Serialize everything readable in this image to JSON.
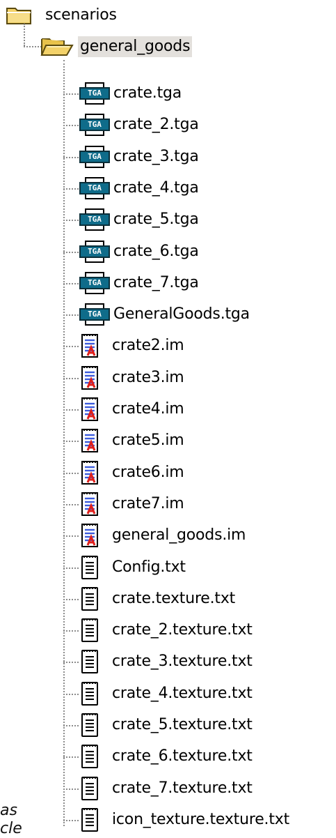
{
  "root": {
    "label": "scenarios",
    "icon": "folder-icon"
  },
  "folder": {
    "label": "general_goods",
    "icon": "folder-open-icon",
    "selected": true
  },
  "files": [
    {
      "label": "crate.tga",
      "icon": "tga-icon"
    },
    {
      "label": "crate_2.tga",
      "icon": "tga-icon"
    },
    {
      "label": "crate_3.tga",
      "icon": "tga-icon"
    },
    {
      "label": "crate_4.tga",
      "icon": "tga-icon"
    },
    {
      "label": "crate_5.tga",
      "icon": "tga-icon"
    },
    {
      "label": "crate_6.tga",
      "icon": "tga-icon"
    },
    {
      "label": "crate_7.tga",
      "icon": "tga-icon"
    },
    {
      "label": "GeneralGoods.tga",
      "icon": "tga-icon"
    },
    {
      "label": "crate2.im",
      "icon": "im-file-icon"
    },
    {
      "label": "crate3.im",
      "icon": "im-file-icon"
    },
    {
      "label": "crate4.im",
      "icon": "im-file-icon"
    },
    {
      "label": "crate5.im",
      "icon": "im-file-icon"
    },
    {
      "label": "crate6.im",
      "icon": "im-file-icon"
    },
    {
      "label": "crate7.im",
      "icon": "im-file-icon"
    },
    {
      "label": "general_goods.im",
      "icon": "im-file-icon"
    },
    {
      "label": "Config.txt",
      "icon": "text-file-icon"
    },
    {
      "label": "crate.texture.txt",
      "icon": "text-file-icon"
    },
    {
      "label": "crate_2.texture.txt",
      "icon": "text-file-icon"
    },
    {
      "label": "crate_3.texture.txt",
      "icon": "text-file-icon"
    },
    {
      "label": "crate_4.texture.txt",
      "icon": "text-file-icon"
    },
    {
      "label": "crate_5.texture.txt",
      "icon": "text-file-icon"
    },
    {
      "label": "crate_6.texture.txt",
      "icon": "text-file-icon"
    },
    {
      "label": "crate_7.texture.txt",
      "icon": "text-file-icon"
    },
    {
      "label": "icon_texture.texture.txt",
      "icon": "text-file-icon"
    }
  ],
  "tga_badge": "TGA",
  "edge_text": {
    "line1": "as",
    "line2": "cle"
  },
  "colors": {
    "selection": "#e3e0dc",
    "folder_yellow": "#f3d26a",
    "tga_teal": "#0f6c8a",
    "im_blue": "#3b5bdc",
    "im_red": "#e0201c"
  }
}
